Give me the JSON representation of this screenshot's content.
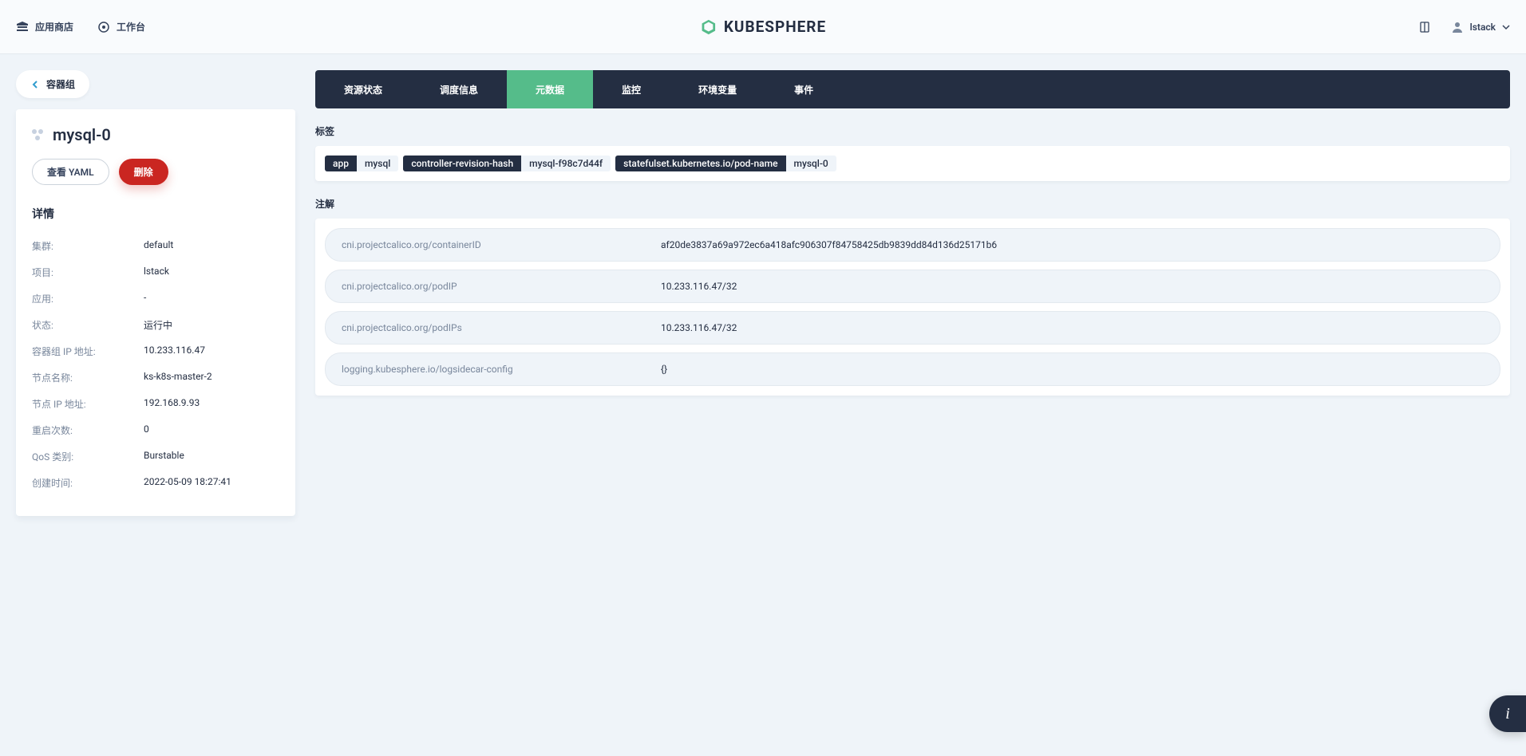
{
  "topbar": {
    "app_store": "应用商店",
    "workbench": "工作台",
    "brand": "KUBESPHERE",
    "user": "lstack"
  },
  "side": {
    "back_label": "容器组",
    "pod_name": "mysql-0",
    "view_yaml": "查看 YAML",
    "delete": "删除",
    "details_title": "详情",
    "details": [
      {
        "key": "集群:",
        "val": "default"
      },
      {
        "key": "项目:",
        "val": "lstack"
      },
      {
        "key": "应用:",
        "val": "-"
      },
      {
        "key": "状态:",
        "val": "运行中"
      },
      {
        "key": "容器组 IP 地址:",
        "val": "10.233.116.47"
      },
      {
        "key": "节点名称:",
        "val": "ks-k8s-master-2"
      },
      {
        "key": "节点 IP 地址:",
        "val": "192.168.9.93"
      },
      {
        "key": "重启次数:",
        "val": "0"
      },
      {
        "key": "QoS 类别:",
        "val": "Burstable"
      },
      {
        "key": "创建时间:",
        "val": "2022-05-09 18:27:41"
      }
    ]
  },
  "tabs": [
    {
      "label": "资源状态",
      "active": false
    },
    {
      "label": "调度信息",
      "active": false
    },
    {
      "label": "元数据",
      "active": true
    },
    {
      "label": "监控",
      "active": false
    },
    {
      "label": "环境变量",
      "active": false
    },
    {
      "label": "事件",
      "active": false
    }
  ],
  "sections": {
    "labels_title": "标签",
    "annotations_title": "注解"
  },
  "labels": [
    {
      "key": "app",
      "val": "mysql"
    },
    {
      "key": "controller-revision-hash",
      "val": "mysql-f98c7d44f"
    },
    {
      "key": "statefulset.kubernetes.io/pod-name",
      "val": "mysql-0"
    }
  ],
  "annotations": [
    {
      "key": "cni.projectcalico.org/containerID",
      "val": "af20de3837a69a972ec6a418afc906307f84758425db9839dd84d136d25171b6"
    },
    {
      "key": "cni.projectcalico.org/podIP",
      "val": "10.233.116.47/32"
    },
    {
      "key": "cni.projectcalico.org/podIPs",
      "val": "10.233.116.47/32"
    },
    {
      "key": "logging.kubesphere.io/logsidecar-config",
      "val": "{}"
    }
  ],
  "fab": {
    "label": "i"
  }
}
